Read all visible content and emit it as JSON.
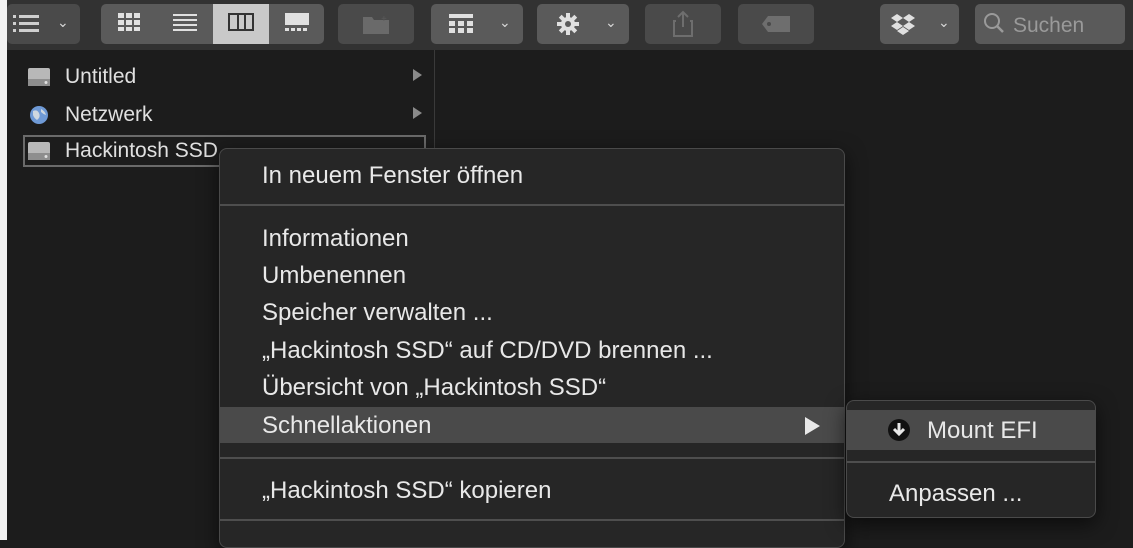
{
  "toolbar": {
    "search_placeholder": "Suchen",
    "buttons": [
      {
        "name": "view-options",
        "icon": "list-lines-icon"
      },
      {
        "name": "view-icons",
        "icon": "grid-icon"
      },
      {
        "name": "view-list",
        "icon": "list-icon"
      },
      {
        "name": "view-columns",
        "icon": "columns-icon"
      },
      {
        "name": "view-gallery",
        "icon": "gallery-icon"
      },
      {
        "name": "new-folder",
        "icon": "folder-plus-icon"
      },
      {
        "name": "group",
        "icon": "group-grid-icon"
      },
      {
        "name": "action",
        "icon": "gear-icon"
      },
      {
        "name": "share",
        "icon": "share-icon"
      },
      {
        "name": "tag",
        "icon": "tag-icon"
      },
      {
        "name": "dropbox",
        "icon": "dropbox-icon"
      }
    ]
  },
  "sidebar": {
    "items": [
      {
        "label": "Untitled",
        "icon": "disk-icon"
      },
      {
        "label": "Netzwerk",
        "icon": "globe-icon"
      },
      {
        "label": "Hackintosh SSD",
        "icon": "disk-icon",
        "selected": true
      }
    ]
  },
  "context_menu": {
    "items": [
      {
        "label": "In neuem Fenster öffnen"
      },
      {
        "label": "Informationen"
      },
      {
        "label": "Umbenennen"
      },
      {
        "label": "Speicher verwalten ..."
      },
      {
        "label": "„Hackintosh SSD“ auf CD/DVD brennen ..."
      },
      {
        "label": "Übersicht von „Hackintosh SSD“"
      },
      {
        "label": "Schnellaktionen",
        "highlighted": true,
        "submenu": true
      },
      {
        "label": "„Hackintosh SSD“ kopieren"
      }
    ]
  },
  "submenu": {
    "items": [
      {
        "label": "Mount EFI",
        "icon": "download-circle-icon",
        "highlighted": true
      },
      {
        "label": "Anpassen ..."
      }
    ]
  },
  "colors": {
    "background": "#1e1e1e",
    "toolbar": "#323232",
    "menu_bg": "#262626",
    "menu_highlight": "#4a4a4a",
    "text": "#e8e8e8"
  }
}
